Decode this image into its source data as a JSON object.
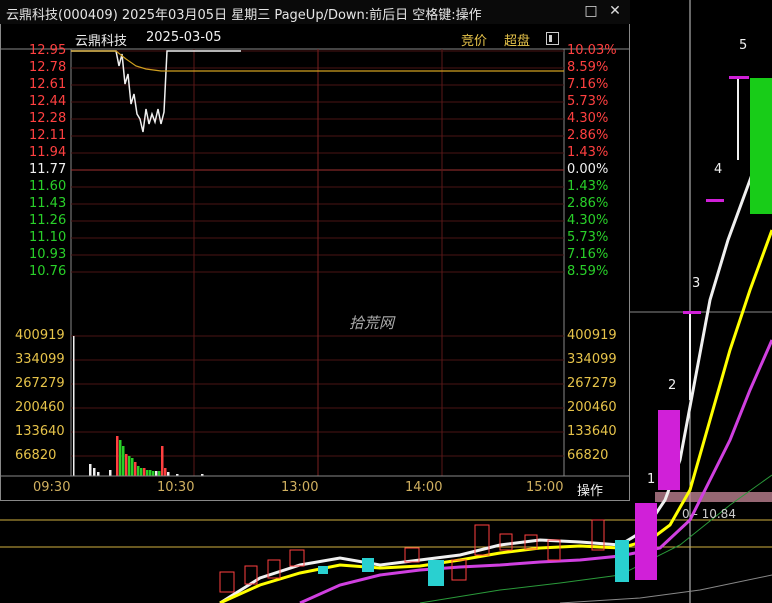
{
  "window": {
    "title": "云鼎科技(000409) 2025年03月05日 星期三 PageUp/Down:前后日 空格键:操作",
    "restore_glyph": "□",
    "close_glyph": "✕"
  },
  "header": {
    "stock_name": "云鼎科技",
    "date": "2025-03-05",
    "btn_auction": "竞价",
    "btn_superboard": "超盘",
    "toggle_icon": "panel-toggle-icon"
  },
  "price_axis": {
    "left": [
      "12.95",
      "12.78",
      "12.61",
      "12.44",
      "12.28",
      "12.11",
      "11.94",
      "11.77",
      "11.60",
      "11.43",
      "11.26",
      "11.10",
      "10.93",
      "10.76"
    ],
    "right": [
      "10.03%",
      "8.59%",
      "7.16%",
      "5.73%",
      "4.30%",
      "2.86%",
      "1.43%",
      "0.00%",
      "1.43%",
      "2.86%",
      "4.30%",
      "5.73%",
      "7.16%",
      "8.59%"
    ],
    "prev_close": "11.77"
  },
  "volume_axis": {
    "left": [
      "400919",
      "334099",
      "267279",
      "200460",
      "133640",
      "66820"
    ],
    "right": [
      "400919",
      "334099",
      "267279",
      "200460",
      "133640",
      "66820"
    ]
  },
  "time_axis": [
    "09:30",
    "10:30",
    "13:00",
    "14:00",
    "15:00"
  ],
  "operate_label": "操作",
  "watermark": "拾荒网",
  "main_chart": {
    "markers": [
      "1",
      "2",
      "3",
      "4",
      "5"
    ],
    "price_label": "0 - 10.84"
  },
  "colors": {
    "up": "#ff4040",
    "down": "#29d029",
    "neutral": "#f0f0f0",
    "ma_yellow": "#ffff00",
    "ma_magenta": "#d040e0",
    "candle_up": "#d020d8"
  }
}
